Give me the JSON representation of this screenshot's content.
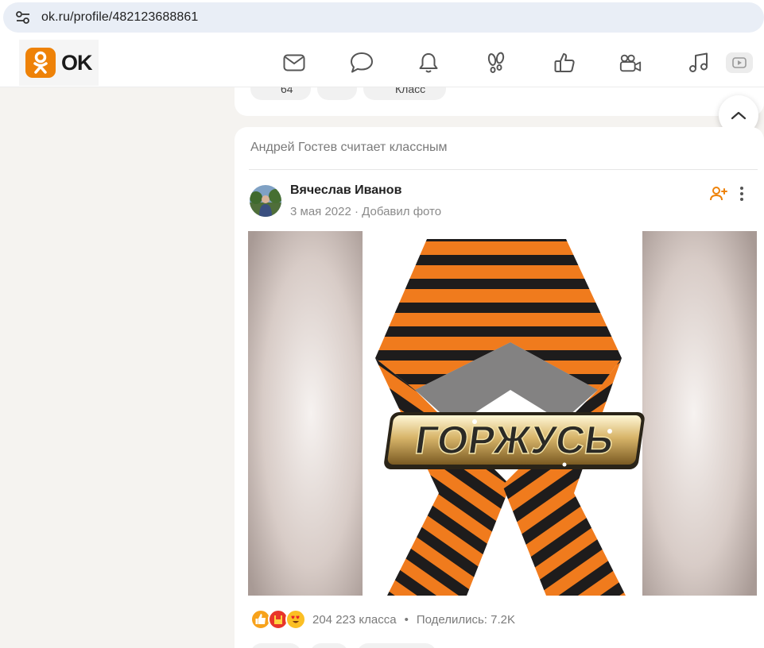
{
  "browser": {
    "url": "ok.ru/profile/482123688861",
    "site_info_icon": "tune-icon"
  },
  "header": {
    "logo_text": "OK",
    "brand_color": "#ee8208",
    "nav_icons": [
      "mail-icon",
      "chat-icon",
      "bell-icon",
      "footprints-icon",
      "like-icon",
      "video-camera-icon",
      "music-icon",
      "video-play-icon"
    ]
  },
  "previous_post": {
    "comments_count": "64",
    "like_label": "Класс"
  },
  "feed": {
    "card_header": "Андрей Гостев считает классным",
    "author": "Вячеслав Иванов",
    "date": "3 мая 2022",
    "action": "Добавил фото",
    "meta_separator": " · ",
    "photo_text": "ГОРЖУСЬ",
    "likes_text": "204 223 класса",
    "stats_separator": "•",
    "shares_text": "Поделились: 7.2K",
    "reaction_icons": [
      "thumbs-up-icon",
      "rock-hand-icon",
      "heart-eyes-icon"
    ]
  }
}
